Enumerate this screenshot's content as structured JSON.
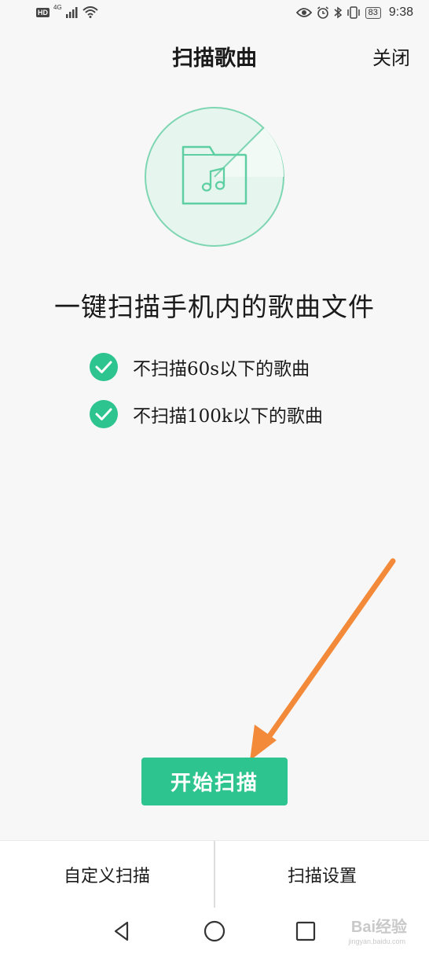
{
  "status_bar": {
    "hd": "HD",
    "network": "4G",
    "battery": "83",
    "time": "9:38"
  },
  "header": {
    "title": "扫描歌曲",
    "close_label": "关闭"
  },
  "hero": {
    "icon": "music-folder-icon"
  },
  "headline": "一键扫描手机内的歌曲文件",
  "rules": [
    "不扫描60s以下的歌曲",
    "不扫描100k以下的歌曲"
  ],
  "start_button": "开始扫描",
  "bottom_bar": {
    "custom_scan": "自定义扫描",
    "scan_settings": "扫描设置"
  },
  "watermark": {
    "text": "Bai经验",
    "sub": "jingyan.baidu.com"
  },
  "colors": {
    "accent": "#2ec48f",
    "arrow": "#f28a3a"
  }
}
